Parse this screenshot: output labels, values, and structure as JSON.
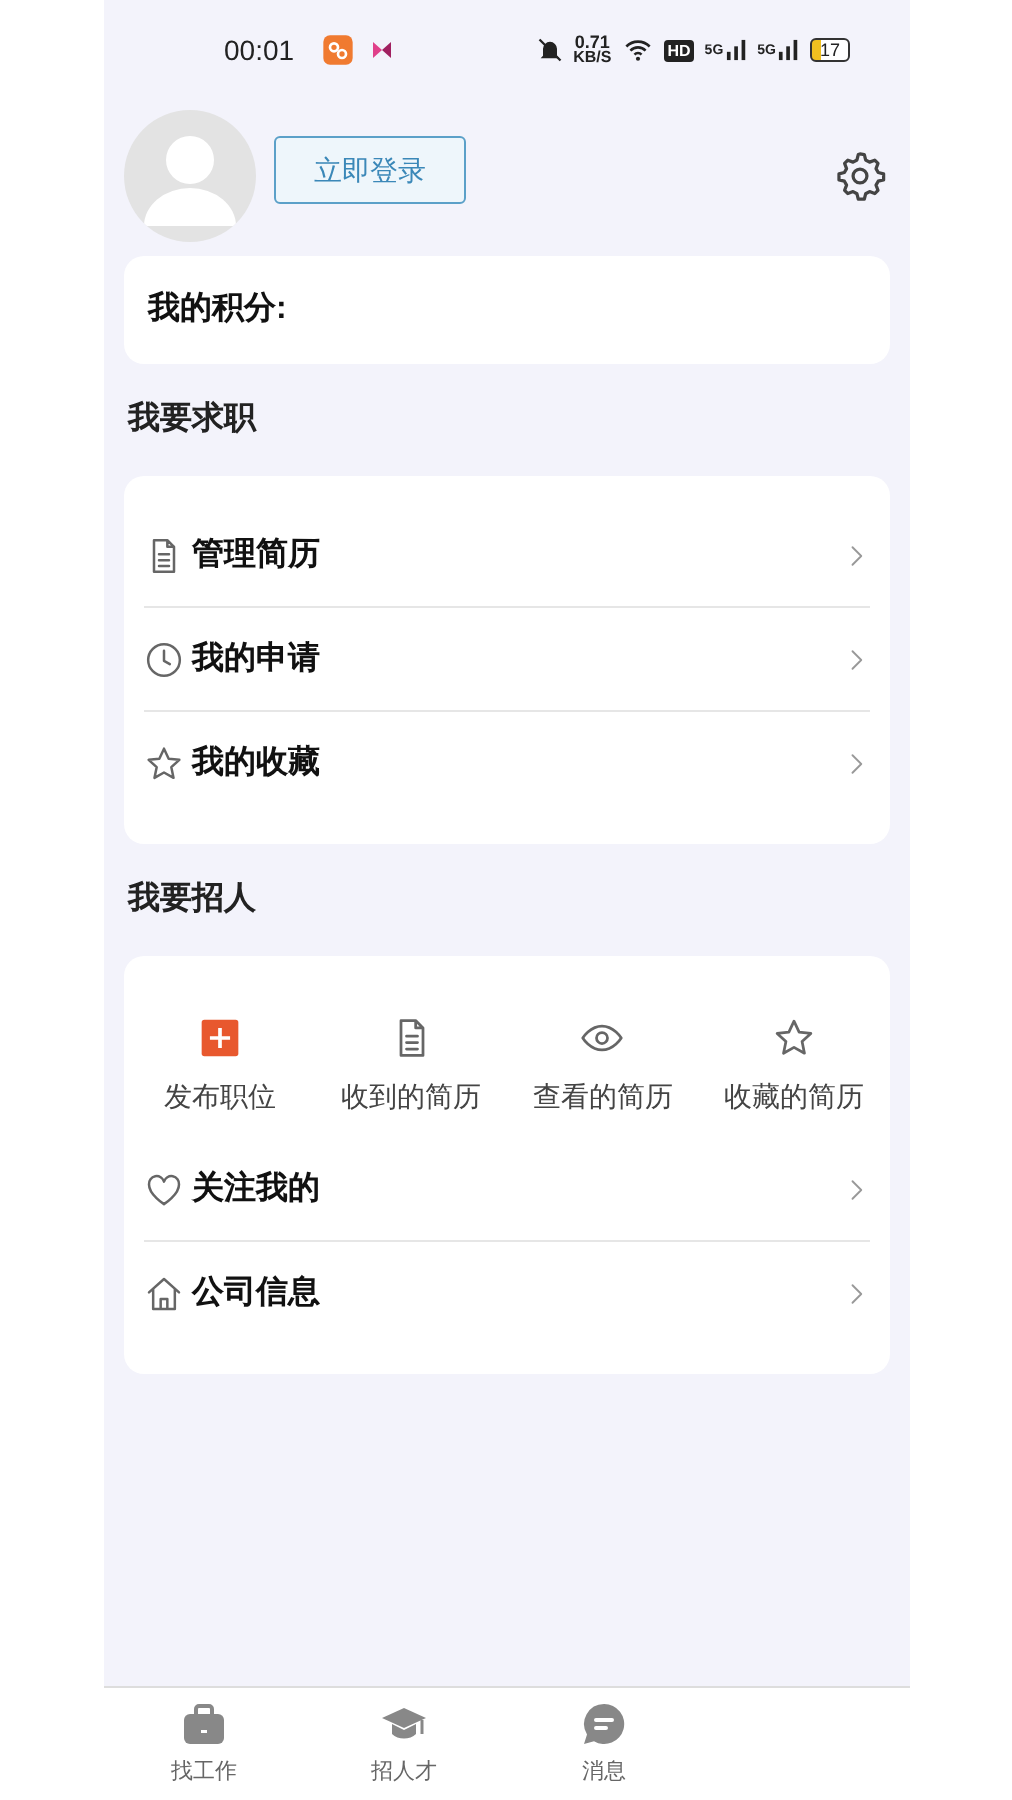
{
  "status_bar": {
    "time": "00:01",
    "net_speed": "0.71",
    "net_unit": "KB/S",
    "hd": "HD",
    "signals": [
      "5G",
      "5G"
    ],
    "battery": "17"
  },
  "profile": {
    "login_button": "立即登录"
  },
  "points": {
    "label": "我的积分:"
  },
  "job_seeking": {
    "title": "我要求职",
    "items": [
      {
        "label": "管理简历"
      },
      {
        "label": "我的申请"
      },
      {
        "label": "我的收藏"
      }
    ]
  },
  "recruiting": {
    "title": "我要招人",
    "shortcuts": [
      {
        "label": "发布职位"
      },
      {
        "label": "收到的简历"
      },
      {
        "label": "查看的简历"
      },
      {
        "label": "收藏的简历"
      }
    ],
    "items": [
      {
        "label": "关注我的"
      },
      {
        "label": "公司信息"
      }
    ]
  },
  "bottom_nav": [
    {
      "label": "找工作",
      "selected": false
    },
    {
      "label": "招人才",
      "selected": false
    },
    {
      "label": "消息",
      "selected": false
    }
  ]
}
